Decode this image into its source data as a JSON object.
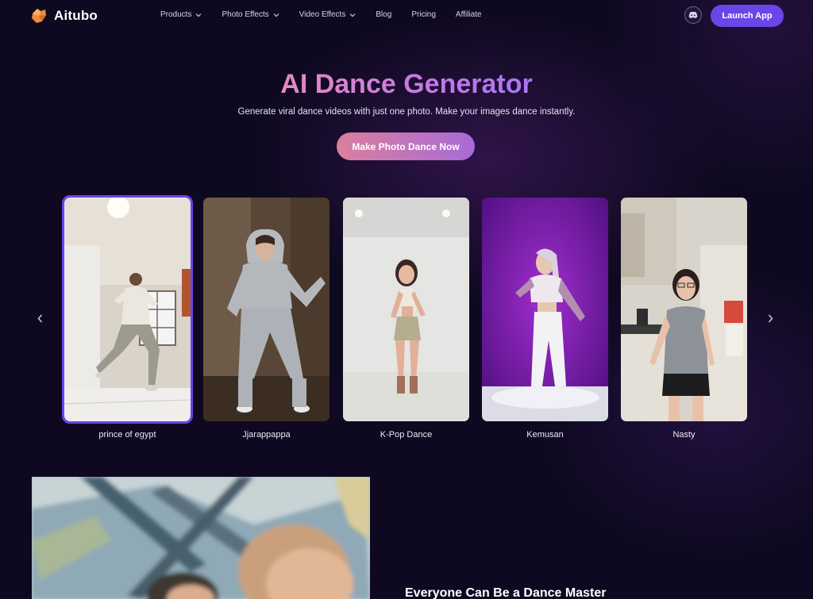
{
  "brand": {
    "name": "Aitubo"
  },
  "nav": {
    "items": [
      {
        "label": "Products",
        "has_dropdown": true
      },
      {
        "label": "Photo Effects",
        "has_dropdown": true
      },
      {
        "label": "Video Effects",
        "has_dropdown": true
      },
      {
        "label": "Blog",
        "has_dropdown": false
      },
      {
        "label": "Pricing",
        "has_dropdown": false
      },
      {
        "label": "Affiliate",
        "has_dropdown": false
      }
    ],
    "discord_icon": "discord-icon",
    "launch_label": "Launch App"
  },
  "hero": {
    "title": "AI Dance Generator",
    "subtitle": "Generate viral dance videos with just one photo. Make your images dance instantly.",
    "cta_label": "Make Photo Dance Now"
  },
  "carousel": {
    "selected_index": 0,
    "cards": [
      {
        "label": "prince of egypt"
      },
      {
        "label": "Jjarappappa"
      },
      {
        "label": "K-Pop Dance"
      },
      {
        "label": "Kemusan"
      },
      {
        "label": "Nasty"
      }
    ]
  },
  "feature": {
    "heading": "Everyone Can Be a Dance Master"
  },
  "colors": {
    "background": "#0e0920",
    "accent": "#6b45e8",
    "title_gradient_start": "#e48ac2",
    "title_gradient_end": "#a974f3",
    "cta_gradient_start": "#db7f9e",
    "cta_gradient_end": "#a86ad8"
  }
}
